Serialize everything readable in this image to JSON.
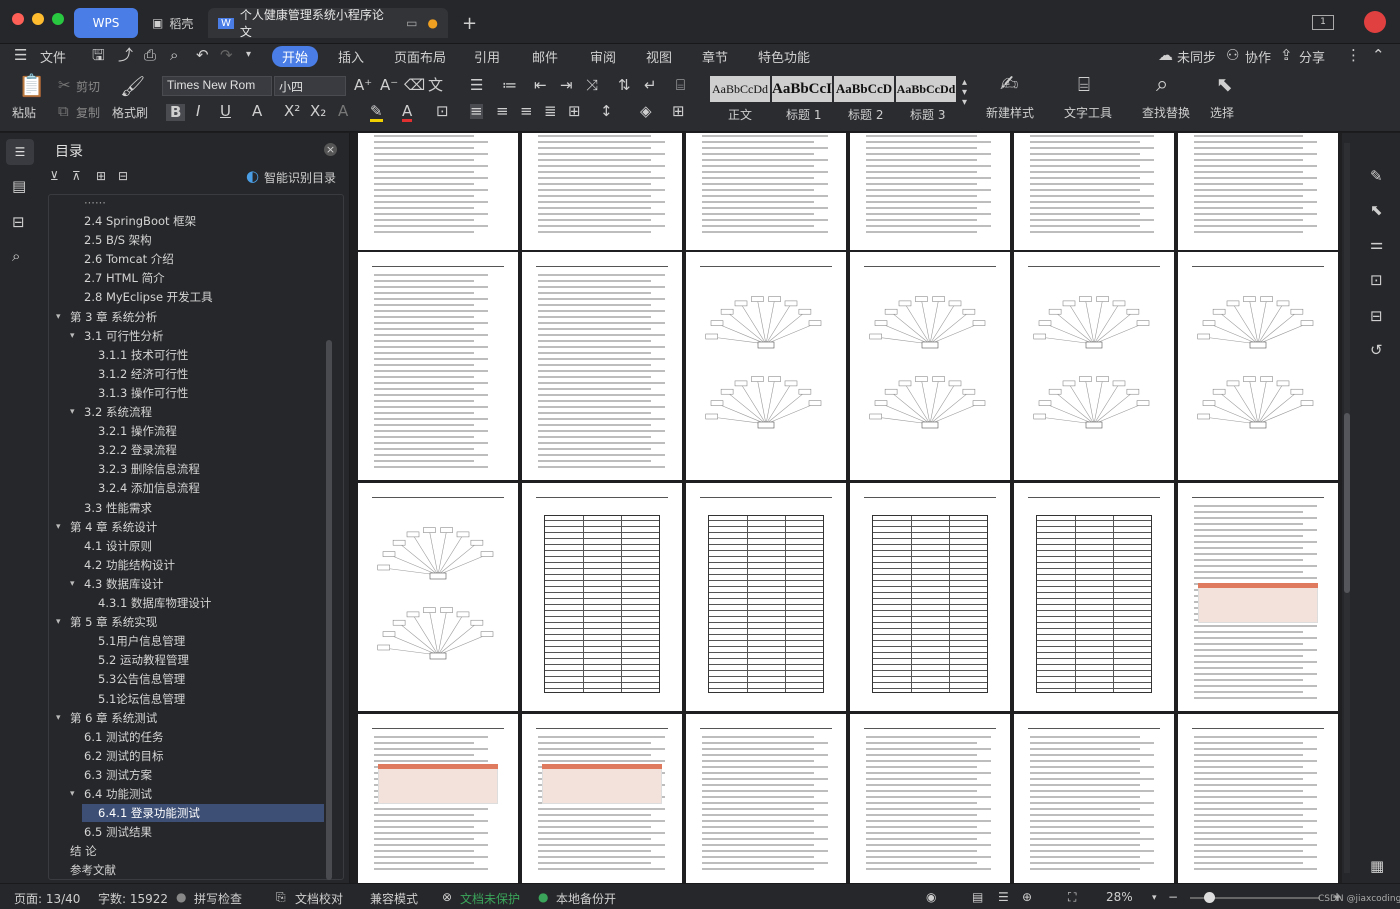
{
  "titlebar": {
    "wps_tab": "WPS",
    "daoke_tab": "稻壳",
    "doc_tab": "个人健康管理系统小程序论文",
    "add_tab": "+",
    "window_badge": "1"
  },
  "menu": {
    "file": "文件",
    "tabs": [
      "开始",
      "插入",
      "页面布局",
      "引用",
      "邮件",
      "审阅",
      "视图",
      "章节",
      "特色功能"
    ],
    "active_tab": "开始",
    "unsync": "未同步",
    "collab": "协作",
    "share": "分享"
  },
  "toolbar": {
    "paste": "粘贴",
    "cut": "剪切",
    "copy": "复制",
    "format_painter": "格式刷",
    "font_name": "Times New Rom",
    "font_size": "小四",
    "styles": [
      {
        "preview": "AaBbCcDd",
        "label": "正文"
      },
      {
        "preview": "AaBbCcI",
        "label": "标题 1"
      },
      {
        "preview": "AaBbCcD",
        "label": "标题 2"
      },
      {
        "preview": "AaBbCcDd",
        "label": "标题 3"
      }
    ],
    "new_style": "新建样式",
    "text_tool": "文字工具",
    "find_replace": "查找替换",
    "select": "选择"
  },
  "outline": {
    "title": "目录",
    "smart": "智能识别目录",
    "items": [
      {
        "text": "2.4 SpringBoot 框架",
        "level": 2
      },
      {
        "text": "2.5 B/S 架构",
        "level": 2
      },
      {
        "text": "2.6 Tomcat  介绍",
        "level": 2
      },
      {
        "text": "2.7 HTML 简介",
        "level": 2
      },
      {
        "text": "2.8 MyEclipse 开发工具",
        "level": 2
      },
      {
        "text": "第 3 章  系统分析",
        "level": 1
      },
      {
        "text": "3.1  可行性分析",
        "level": 2
      },
      {
        "text": "3.1.1  技术可行性",
        "level": 3
      },
      {
        "text": "3.1.2  经济可行性",
        "level": 3
      },
      {
        "text": "3.1.3  操作可行性",
        "level": 3
      },
      {
        "text": "3.2  系统流程",
        "level": 2
      },
      {
        "text": "3.2.1  操作流程",
        "level": 3
      },
      {
        "text": "3.2.2  登录流程",
        "level": 3
      },
      {
        "text": "3.2.3  删除信息流程",
        "level": 3
      },
      {
        "text": "3.2.4  添加信息流程",
        "level": 3
      },
      {
        "text": "3.3  性能需求",
        "level": 2
      },
      {
        "text": "第 4 章  系统设计",
        "level": 1
      },
      {
        "text": "4.1  设计原则",
        "level": 2
      },
      {
        "text": "4.2  功能结构设计",
        "level": 2
      },
      {
        "text": "4.3  数据库设计",
        "level": 2
      },
      {
        "text": "4.3.1  数据库物理设计",
        "level": 3
      },
      {
        "text": "第 5 章  系统实现",
        "level": 1
      },
      {
        "text": "5.1用户信息管理",
        "level": 3
      },
      {
        "text": "5.2  运动教程管理",
        "level": 3
      },
      {
        "text": "5.3公告信息管理",
        "level": 3
      },
      {
        "text": "5.1论坛信息管理",
        "level": 3
      },
      {
        "text": "第 6 章  系统测试",
        "level": 1
      },
      {
        "text": "6.1  测试的任务",
        "level": 2
      },
      {
        "text": "6.2  测试的目标",
        "level": 2
      },
      {
        "text": "6.3  测试方案",
        "level": 2
      },
      {
        "text": "6.4  功能测试",
        "level": 2
      },
      {
        "text": "6.4.1  登录功能测试",
        "level": 3
      },
      {
        "text": "6.5  测试结果",
        "level": 2
      },
      {
        "text": "结    论",
        "level": 1
      },
      {
        "text": "参考文献",
        "level": 1
      }
    ],
    "selected": "6.4.1  登录功能测试"
  },
  "status": {
    "page": "页面: 13/40",
    "words": "字数: 15922",
    "spell": "拼写检查",
    "proof": "文档校对",
    "compat": "兼容模式",
    "protect": "文档未保护",
    "backup": "本地备份开",
    "zoom": "28%",
    "watermark": "CSDN @jiaxcoding"
  },
  "colors": {
    "accent": "#4a7ee6",
    "protect_green": "#3aa55a"
  }
}
